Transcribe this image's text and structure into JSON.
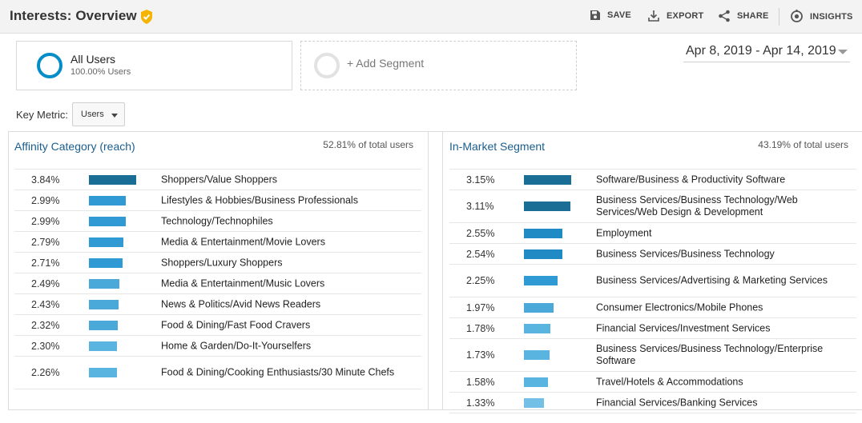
{
  "header": {
    "title": "Interests: Overview",
    "actions": {
      "save": "SAVE",
      "export": "EXPORT",
      "share": "SHARE",
      "insights": "INSIGHTS"
    }
  },
  "segments": {
    "active": {
      "name": "All Users",
      "subtitle": "100.00% Users"
    },
    "add_label": "+ Add Segment"
  },
  "date_range": "Apr 8, 2019 - Apr 14, 2019",
  "key_metric": {
    "label": "Key Metric:",
    "value": "Users"
  },
  "colors": {
    "accent": "#058dc7",
    "bar_shades": [
      "#1a6e96",
      "#1f8ac4",
      "#2f9ad3",
      "#4aa9d9",
      "#5ab4e0",
      "#73bfe6"
    ],
    "title_text": "#1a5e8e",
    "verified_badge": "#f4b400"
  },
  "affinity": {
    "title": "Affinity Category (reach)",
    "total": "52.81% of total users",
    "rows": [
      {
        "pct": "3.84%",
        "value": 3.84,
        "label": "Shoppers/Value Shoppers"
      },
      {
        "pct": "2.99%",
        "value": 2.99,
        "label": "Lifestyles & Hobbies/Business Professionals"
      },
      {
        "pct": "2.99%",
        "value": 2.99,
        "label": "Technology/Technophiles"
      },
      {
        "pct": "2.79%",
        "value": 2.79,
        "label": "Media & Entertainment/Movie Lovers"
      },
      {
        "pct": "2.71%",
        "value": 2.71,
        "label": "Shoppers/Luxury Shoppers"
      },
      {
        "pct": "2.49%",
        "value": 2.49,
        "label": "Media & Entertainment/Music Lovers"
      },
      {
        "pct": "2.43%",
        "value": 2.43,
        "label": "News & Politics/Avid News Readers"
      },
      {
        "pct": "2.32%",
        "value": 2.32,
        "label": "Food & Dining/Fast Food Cravers"
      },
      {
        "pct": "2.30%",
        "value": 2.3,
        "label": "Home & Garden/Do-It-Yourselfers"
      },
      {
        "pct": "2.26%",
        "value": 2.26,
        "label": "Food & Dining/Cooking Enthusiasts/30 Minute Chefs"
      }
    ]
  },
  "in_market": {
    "title": "In-Market Segment",
    "total": "43.19% of total users",
    "rows": [
      {
        "pct": "3.15%",
        "value": 3.15,
        "label": "Software/Business & Productivity Software"
      },
      {
        "pct": "3.11%",
        "value": 3.11,
        "label": "Business Services/Business Technology/Web Services/Web Design & Development"
      },
      {
        "pct": "2.55%",
        "value": 2.55,
        "label": "Employment"
      },
      {
        "pct": "2.54%",
        "value": 2.54,
        "label": "Business Services/Business Technology"
      },
      {
        "pct": "2.25%",
        "value": 2.25,
        "label": "Business Services/Advertising & Marketing Services"
      },
      {
        "pct": "1.97%",
        "value": 1.97,
        "label": "Consumer Electronics/Mobile Phones"
      },
      {
        "pct": "1.78%",
        "value": 1.78,
        "label": "Financial Services/Investment Services"
      },
      {
        "pct": "1.73%",
        "value": 1.73,
        "label": "Business Services/Business Technology/Enterprise Software"
      },
      {
        "pct": "1.58%",
        "value": 1.58,
        "label": "Travel/Hotels & Accommodations"
      },
      {
        "pct": "1.33%",
        "value": 1.33,
        "label": "Financial Services/Banking Services"
      }
    ]
  }
}
